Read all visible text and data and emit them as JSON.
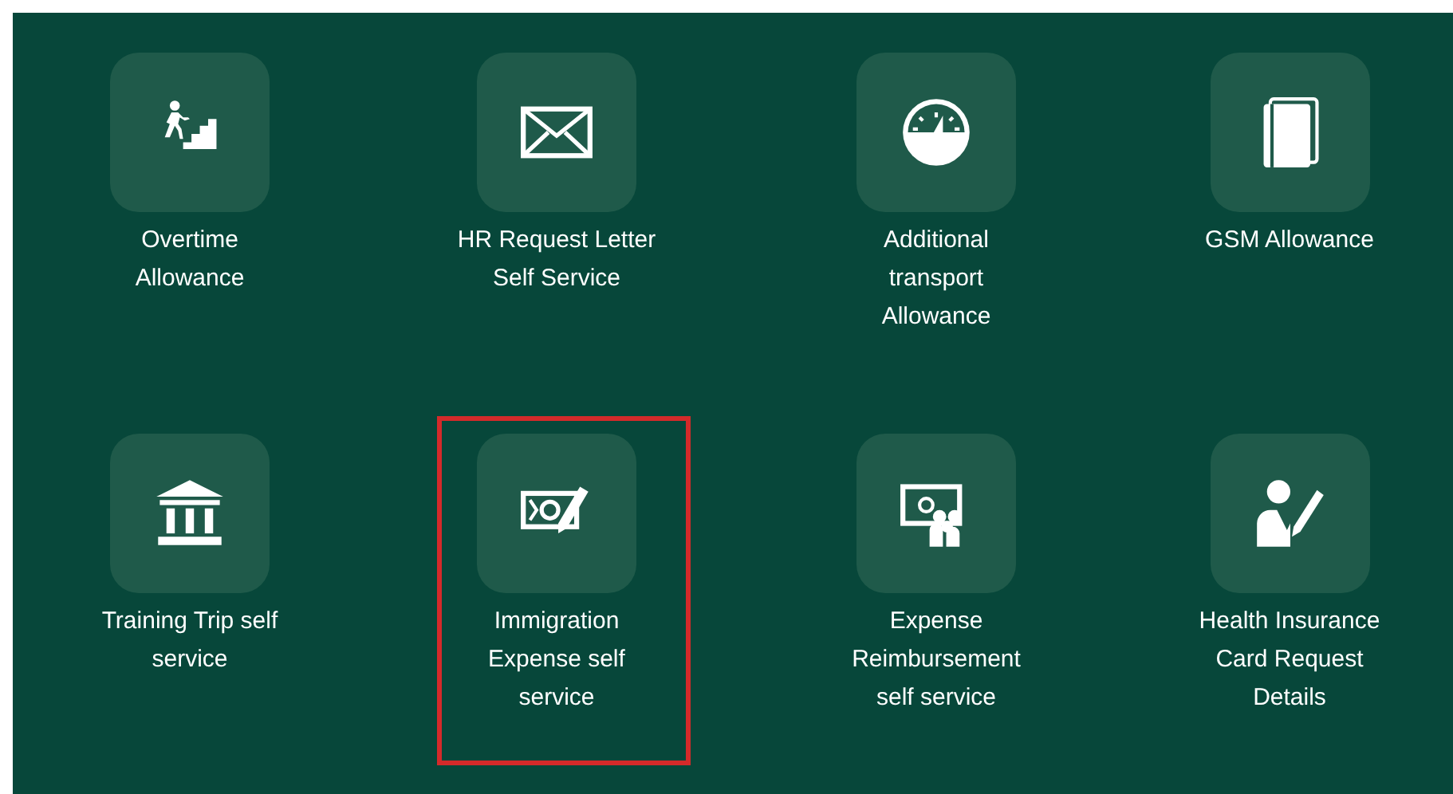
{
  "tiles": [
    {
      "label": [
        "Overtime",
        "Allowance"
      ],
      "highlighted": false
    },
    {
      "label": [
        "HR Request Letter",
        "Self Service"
      ],
      "highlighted": false
    },
    {
      "label": [
        "Additional",
        "transport",
        "Allowance"
      ],
      "highlighted": false
    },
    {
      "label": [
        "GSM Allowance"
      ],
      "highlighted": false
    },
    {
      "label": [
        "Training Trip self",
        "service"
      ],
      "highlighted": false
    },
    {
      "label": [
        "Immigration",
        "Expense self",
        "service"
      ],
      "highlighted": true
    },
    {
      "label": [
        "Expense",
        "Reimbursement",
        "self service"
      ],
      "highlighted": false
    },
    {
      "label": [
        "Health Insurance",
        "Card Request",
        "Details"
      ],
      "highlighted": false
    }
  ]
}
